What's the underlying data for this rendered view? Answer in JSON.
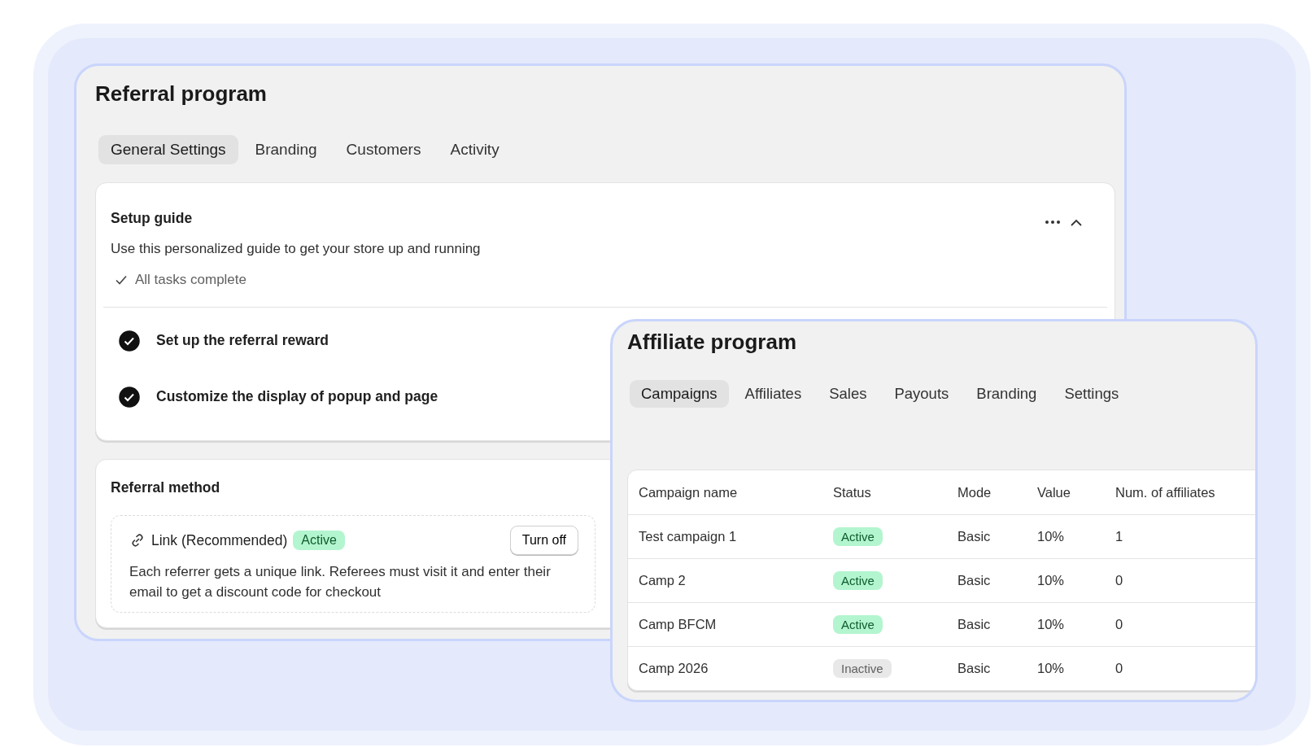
{
  "referral_program": {
    "title": "Referral program",
    "tabs": [
      {
        "label": "General Settings",
        "selected": true
      },
      {
        "label": "Branding",
        "selected": false
      },
      {
        "label": "Customers",
        "selected": false
      },
      {
        "label": "Activity",
        "selected": false
      }
    ],
    "setup_guide": {
      "title": "Setup guide",
      "description": "Use this personalized guide to get your store up and running",
      "status": "All tasks complete",
      "expanded": true,
      "tasks": [
        {
          "label": "Set up the referral reward",
          "completed": true
        },
        {
          "label": "Customize the display of popup and page",
          "completed": true
        }
      ]
    },
    "referral_method": {
      "title": "Referral method",
      "method": {
        "name": "Link (Recommended)",
        "badge": "Active",
        "active": true,
        "button": "Turn off",
        "description": "Each referrer gets a unique link. Referees must visit it and enter their email to get a discount code for checkout"
      }
    }
  },
  "affiliate_program": {
    "title": "Affiliate program",
    "tabs": [
      {
        "label": "Campaigns",
        "selected": true
      },
      {
        "label": "Affiliates",
        "selected": false
      },
      {
        "label": "Sales",
        "selected": false
      },
      {
        "label": "Payouts",
        "selected": false
      },
      {
        "label": "Branding",
        "selected": false
      },
      {
        "label": "Settings",
        "selected": false
      }
    ],
    "table": {
      "columns": [
        "Campaign name",
        "Status",
        "Mode",
        "Value",
        "Num. of affiliates"
      ],
      "rows": [
        {
          "name": "Test campaign 1",
          "status": "Active",
          "active": true,
          "mode": "Basic",
          "value": "10%",
          "affiliates": "1"
        },
        {
          "name": "Camp 2",
          "status": "Active",
          "active": true,
          "mode": "Basic",
          "value": "10%",
          "affiliates": "0"
        },
        {
          "name": "Camp BFCM",
          "status": "Active",
          "active": true,
          "mode": "Basic",
          "value": "10%",
          "affiliates": "0"
        },
        {
          "name": "Camp 2026",
          "status": "Inactive",
          "active": false,
          "mode": "Basic",
          "value": "10%",
          "affiliates": "0"
        }
      ]
    }
  }
}
